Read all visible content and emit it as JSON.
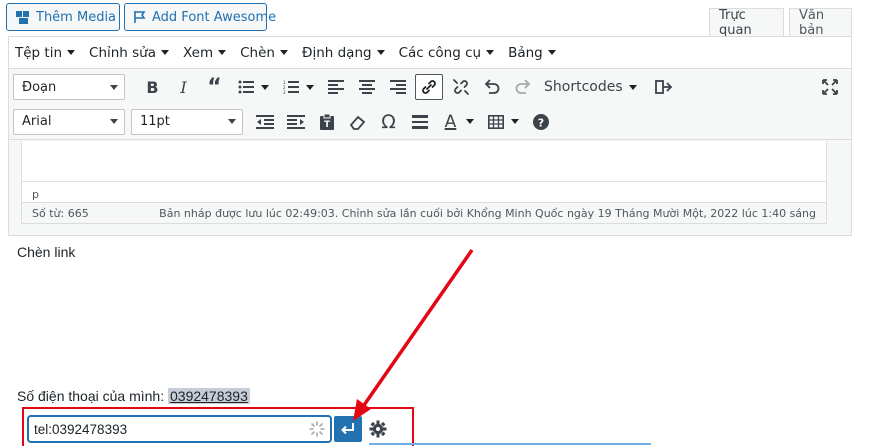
{
  "media_buttons": {
    "add_media": "Thêm Media",
    "add_font_awesome": "Add Font Awesome"
  },
  "editor_tabs": {
    "visual": "Trực quan",
    "text": "Văn bản"
  },
  "menubar": {
    "items": [
      "Tệp tin",
      "Chỉnh sửa",
      "Xem",
      "Chèn",
      "Định dạng",
      "Các công cụ",
      "Bảng"
    ]
  },
  "toolbar1": {
    "format_select": "Đoạn",
    "shortcodes": "Shortcodes"
  },
  "toolbar2": {
    "font_family": "Arial",
    "font_size": "11pt"
  },
  "editor": {
    "path": "p",
    "word_count": "Số từ: 665",
    "draft_status": "Bản nháp được lưu lúc 02:49:03. Chỉnh sửa lần cuối bởi Khổng Minh Quốc ngày 19 Tháng Mười Một, 2022 lúc 1:40 sáng"
  },
  "content": {
    "heading_text": "Chèn link",
    "phone_label": "Số điện thoại của mình: ",
    "phone_number": "0392478393"
  },
  "link_dialog": {
    "url_value": "tel:0392478393"
  },
  "colors": {
    "accent": "#2271b1",
    "highlight_box": "#e30613",
    "arrow": "#e30613"
  }
}
